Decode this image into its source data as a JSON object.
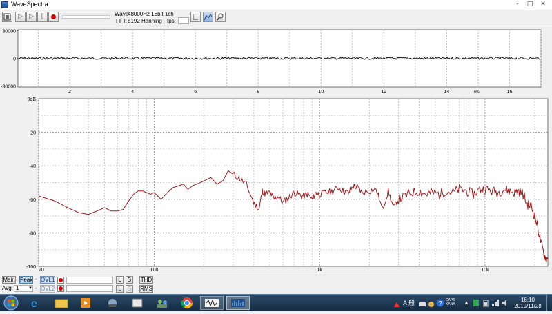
{
  "window": {
    "title": "WaveSpectra",
    "controls": [
      "-",
      "□",
      "✕"
    ]
  },
  "toolbar": {
    "wave_label": "Wave:",
    "wave_value": "48000Hz 16bit 1ch",
    "fft_label": "FFT:",
    "fft_value": "8192 Hanning",
    "fps_label": "fps:",
    "fps_value": ""
  },
  "waveform": {
    "y_ticks": [
      "30000",
      "0",
      "-30000"
    ],
    "x_ticks": [
      "2",
      "4",
      "6",
      "8",
      "10",
      "12",
      "14",
      "16"
    ],
    "x_unit": "ms"
  },
  "spectrum": {
    "y_ticks": [
      "0dB",
      "-20",
      "-40",
      "-60",
      "-80",
      "-100"
    ],
    "x_ticks": [
      "20",
      "100",
      "1k",
      "10k"
    ]
  },
  "chart_data": [
    {
      "type": "line",
      "title": "",
      "xlabel": "ms",
      "ylabel": "",
      "xlim": [
        0.35,
        17
      ],
      "ylim": [
        -31000,
        31000
      ],
      "grid": true,
      "series": [
        {
          "values_note": "",
          "x": [
            0.35,
            17
          ],
          "y": [
            0,
            0
          ]
        }
      ]
    },
    {
      "type": "line",
      "title": "",
      "xlabel": "",
      "ylabel": "",
      "xscale": "log",
      "xlim": [
        20,
        24000
      ],
      "ylim": [
        -100,
        0
      ],
      "grid": true,
      "series": [
        {
          "color": "#a01818",
          "x": [
            20,
            25,
            30,
            35,
            40,
            45,
            50,
            55,
            60,
            65,
            70,
            75,
            80,
            85,
            90,
            95,
            100,
            110,
            120,
            130,
            140,
            150,
            160,
            170,
            180,
            190,
            200,
            220,
            240,
            260,
            280,
            300,
            330,
            360,
            400,
            430,
            450,
            470,
            500,
            530,
            560,
            600,
            650,
            700,
            750,
            800,
            850,
            900,
            950,
            1000,
            1100,
            1200,
            1300,
            1400,
            1500,
            1600,
            1700,
            1800,
            2000,
            2200,
            2400,
            2600,
            2800,
            3000,
            3300,
            3600,
            4000,
            4400,
            4800,
            5300,
            5800,
            6400,
            7000,
            7700,
            8500,
            9300,
            10000,
            11000,
            12000,
            13000,
            14000,
            15000,
            16000,
            17000,
            18000,
            19000,
            20000,
            21000,
            22000,
            23000,
            24000
          ],
          "y": [
            -58,
            -61,
            -65,
            -68,
            -69,
            -67,
            -65,
            -67,
            -67,
            -66,
            -61,
            -57,
            -55,
            -55,
            -56,
            -57,
            -56,
            -60,
            -56,
            -53,
            -52,
            -51,
            -54,
            -52,
            -51,
            -50,
            -49,
            -47,
            -51,
            -49,
            -43,
            -45,
            -48,
            -51,
            -62,
            -66,
            -55,
            -57,
            -56,
            -60,
            -58,
            -62,
            -59,
            -56,
            -57,
            -58,
            -57,
            -60,
            -56,
            -57,
            -56,
            -55,
            -53,
            -55,
            -56,
            -52,
            -53,
            -56,
            -55,
            -54,
            -66,
            -55,
            -65,
            -60,
            -58,
            -56,
            -55,
            -57,
            -56,
            -57,
            -55,
            -56,
            -54,
            -55,
            -57,
            -54,
            -54,
            -55,
            -56,
            -54,
            -55,
            -56,
            -55,
            -57,
            -63,
            -64,
            -70,
            -78,
            -88,
            -94,
            -96
          ]
        }
      ]
    }
  ],
  "bottombar": {
    "main_label": "Main",
    "peak_label": "Peak",
    "ovl1_label": "OVL1",
    "ovl2_label": "OVL2",
    "avg_label": "Avg:",
    "avg_value": "1",
    "l_label": "L",
    "s_label": "S",
    "thd_label": "THD",
    "rms_label": "RMS"
  },
  "taskbar": {
    "time": "16:10",
    "date": "2019/11/28",
    "lang": "A 般"
  }
}
